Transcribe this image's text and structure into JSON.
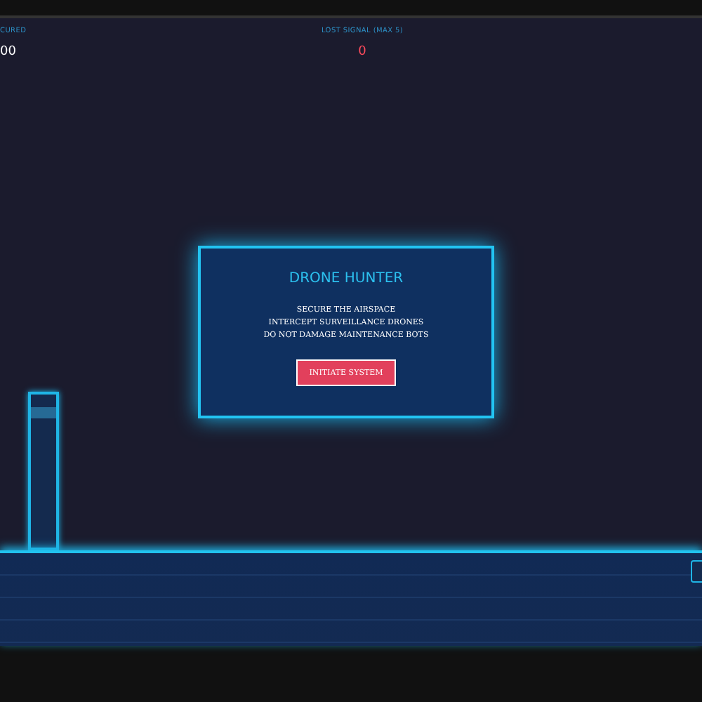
{
  "hud": [
    {
      "label": "CURED",
      "value": "00",
      "kind": "normal"
    },
    {
      "label": "LOST SIGNAL (MAX 5)",
      "value": "0",
      "kind": "alert"
    }
  ],
  "modal": {
    "title": "DRONE HUNTER",
    "lines": [
      "SECURE THE AIRSPACE",
      "INTERCEPT SURVEILLANCE DRONES",
      "DO NOT DAMAGE MAINTENANCE BOTS"
    ],
    "button": "INITIATE SYSTEM"
  }
}
